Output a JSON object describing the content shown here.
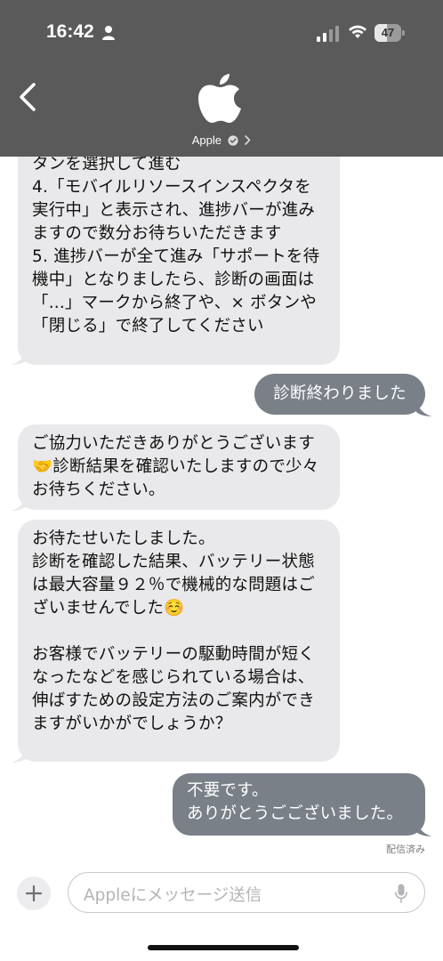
{
  "status_bar": {
    "time": "16:42",
    "battery_level": "47",
    "battery_fraction": 0.47
  },
  "header": {
    "contact_name": "Apple",
    "icons": [
      "back-icon",
      "apple-logo",
      "verified-icon",
      "chevron-right-icon"
    ]
  },
  "messages": [
    {
      "direction": "incoming",
      "text": "タンを選択して進む\n4.「モバイルリソースインスペクタを実行中」と表示され、進捗バーが進みますので数分お待ちいただきます\n5. 進捗バーが全て進み「サポートを待機中」となりましたら、診断の画面は「...」マークから終了や、× ボタンや「閉じる」で終了してください"
    },
    {
      "direction": "outgoing",
      "text": "診断終わりました"
    },
    {
      "direction": "incoming",
      "text": "ご協力いただきありがとうございます🤝診断結果を確認いたしますので少々お待ちください。"
    },
    {
      "direction": "incoming",
      "text": "お待たせいたしました。\n診断を確認した結果、バッテリー状態は最大容量９２％で機械的な問題はございませんでした☺️\n\nお客様でバッテリーの駆動時間が短くなったなどを感じられている場合は、伸ばすための設定方法のご案内ができますがいかがでしょうか？"
    },
    {
      "direction": "outgoing",
      "text": "不要です。\nありがとうごございました。"
    }
  ],
  "delivered_label": "配信済み",
  "composer": {
    "placeholder": "Appleにメッセージ送信"
  },
  "colors": {
    "header_bg": "#5a5a5a",
    "incoming_bubble": "#e9e9eb",
    "outgoing_bubble": "#7a8088"
  }
}
